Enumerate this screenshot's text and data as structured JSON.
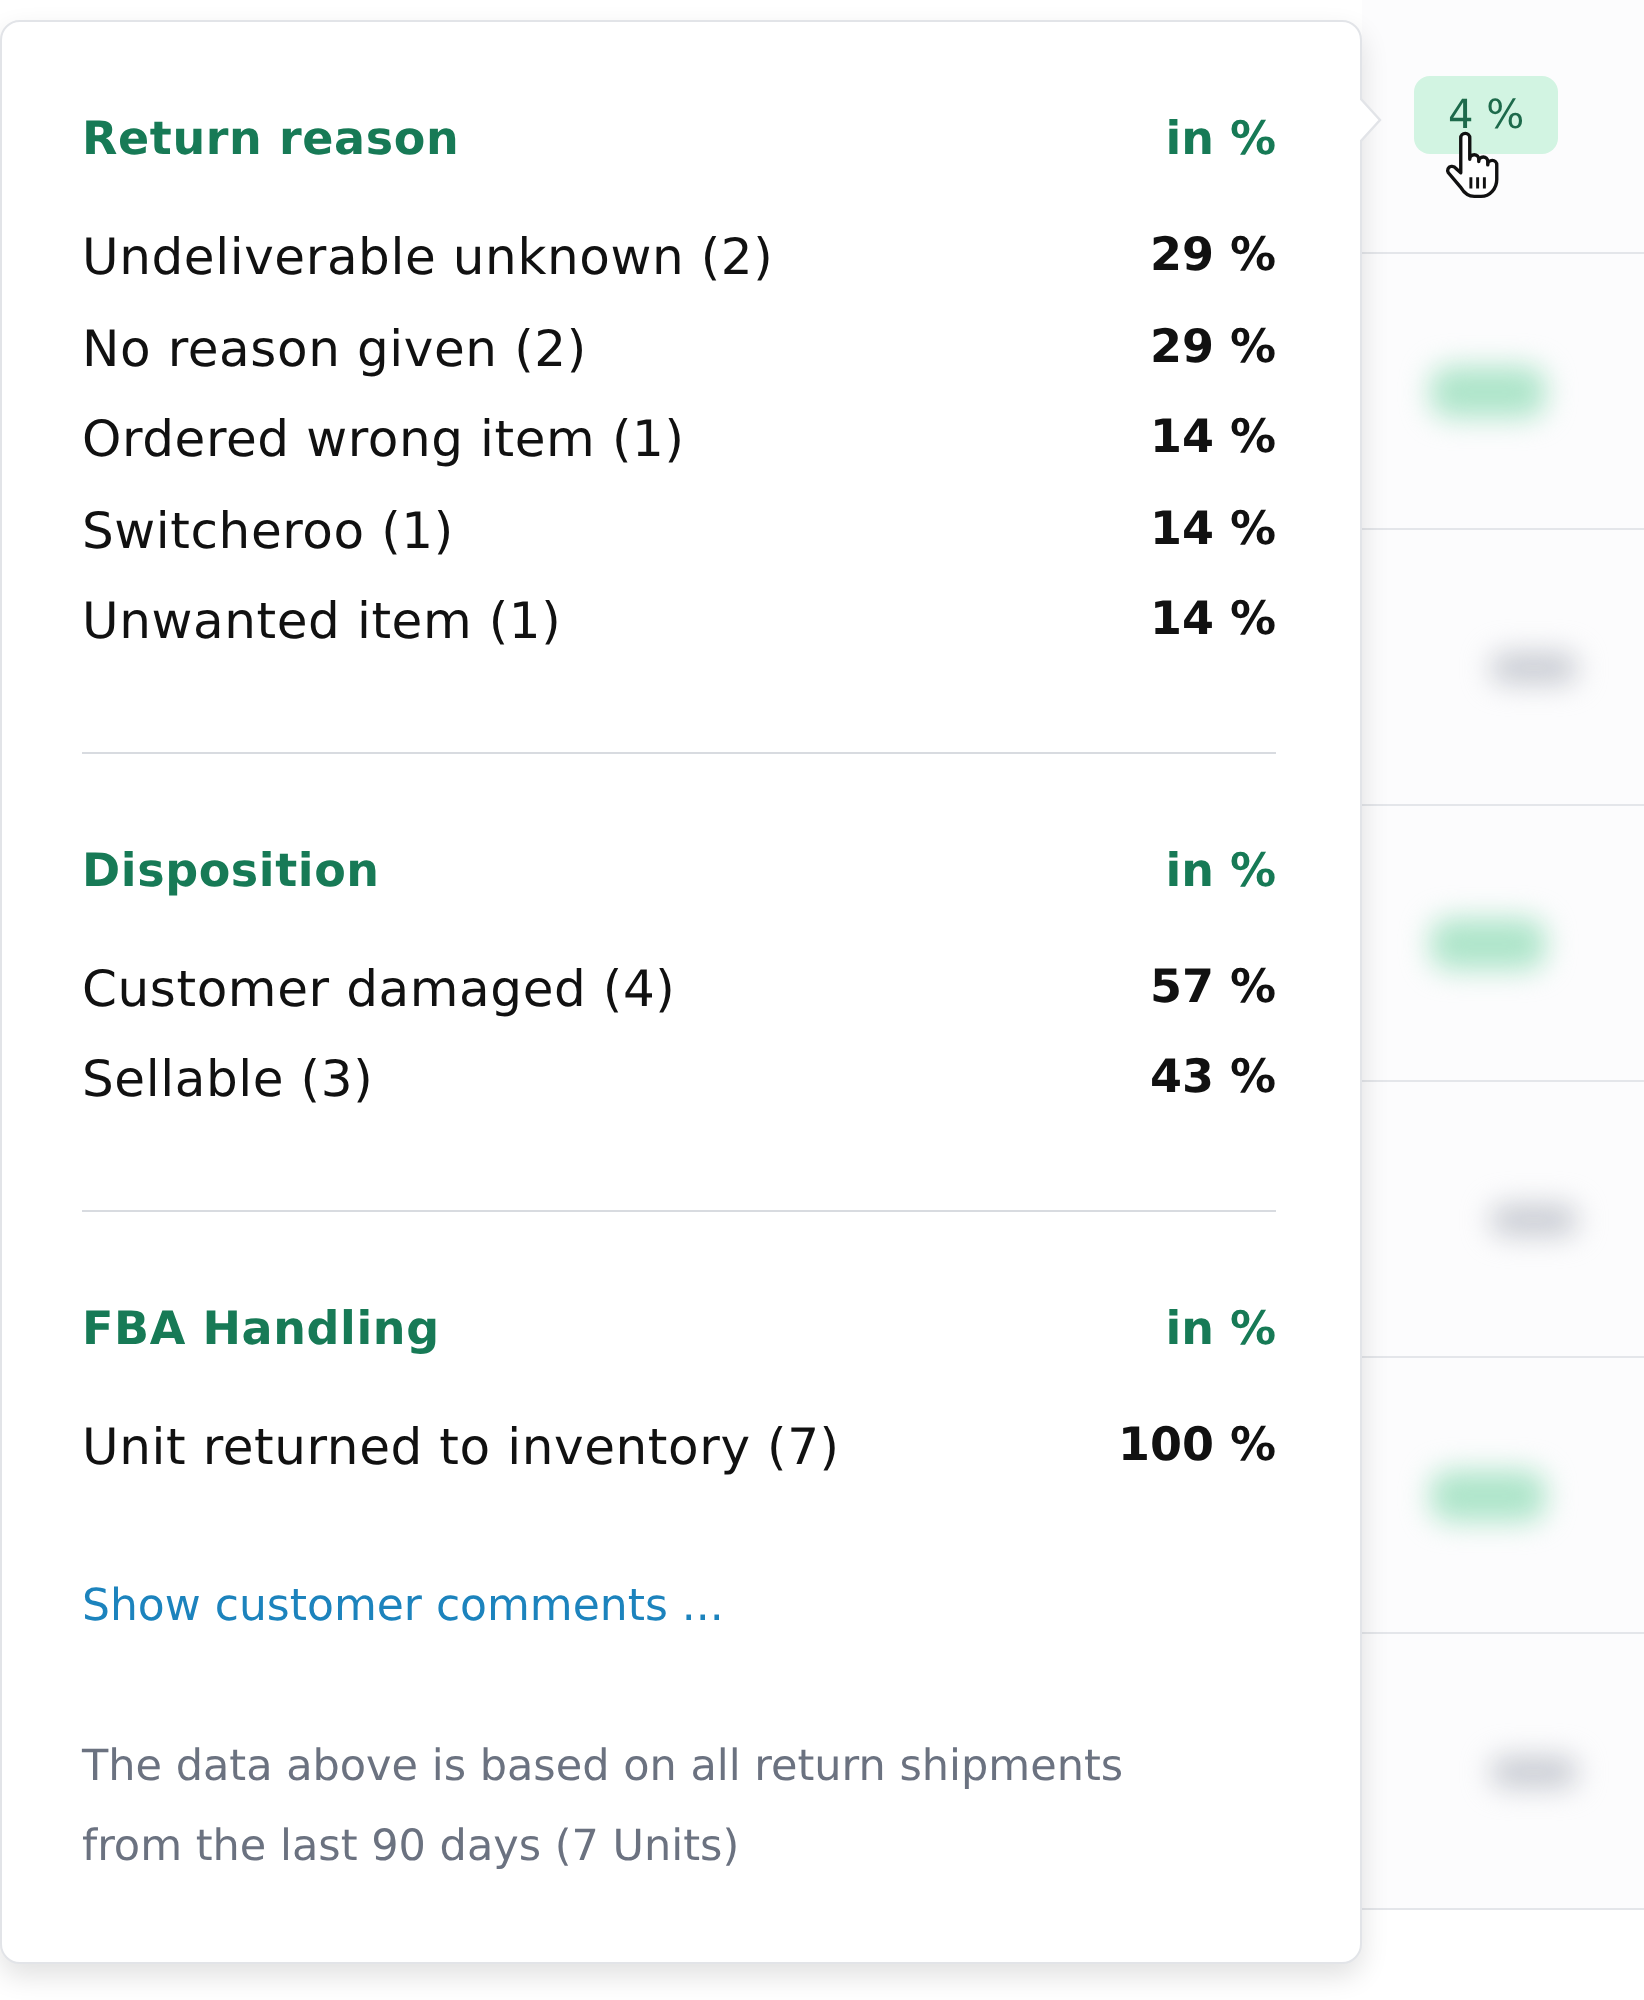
{
  "popover": {
    "sections": [
      {
        "title": "Return reason",
        "unit": "in %",
        "rows": [
          {
            "label": "Undeliverable unknown (2)",
            "value": "29 %"
          },
          {
            "label": "No reason given (2)",
            "value": "29 %"
          },
          {
            "label": "Ordered wrong item (1)",
            "value": "14 %"
          },
          {
            "label": "Switcheroo (1)",
            "value": "14 %"
          },
          {
            "label": "Unwanted item (1)",
            "value": "14 %"
          }
        ]
      },
      {
        "title": "Disposition",
        "unit": "in %",
        "rows": [
          {
            "label": "Customer damaged (4)",
            "value": "57 %"
          },
          {
            "label": "Sellable (3)",
            "value": "43 %"
          }
        ]
      },
      {
        "title": "FBA Handling",
        "unit": "in %",
        "rows": [
          {
            "label": "Unit returned to inventory (7)",
            "value": "100 %"
          }
        ]
      }
    ],
    "link": "Show customer comments ...",
    "footnote": "The data above is based on all return shipments from the last 90 days (7 Units)"
  },
  "table": {
    "rows": [
      {
        "kind": "badge",
        "blurred": false,
        "hovered": true,
        "value": "4 %"
      },
      {
        "kind": "badge",
        "blurred": true,
        "hovered": false
      },
      {
        "kind": "text",
        "blurred": true,
        "hovered": false
      },
      {
        "kind": "badge",
        "blurred": true,
        "hovered": false
      },
      {
        "kind": "text",
        "blurred": true,
        "hovered": false
      },
      {
        "kind": "badge",
        "blurred": true,
        "hovered": false
      },
      {
        "kind": "text",
        "blurred": true,
        "hovered": false
      }
    ]
  }
}
